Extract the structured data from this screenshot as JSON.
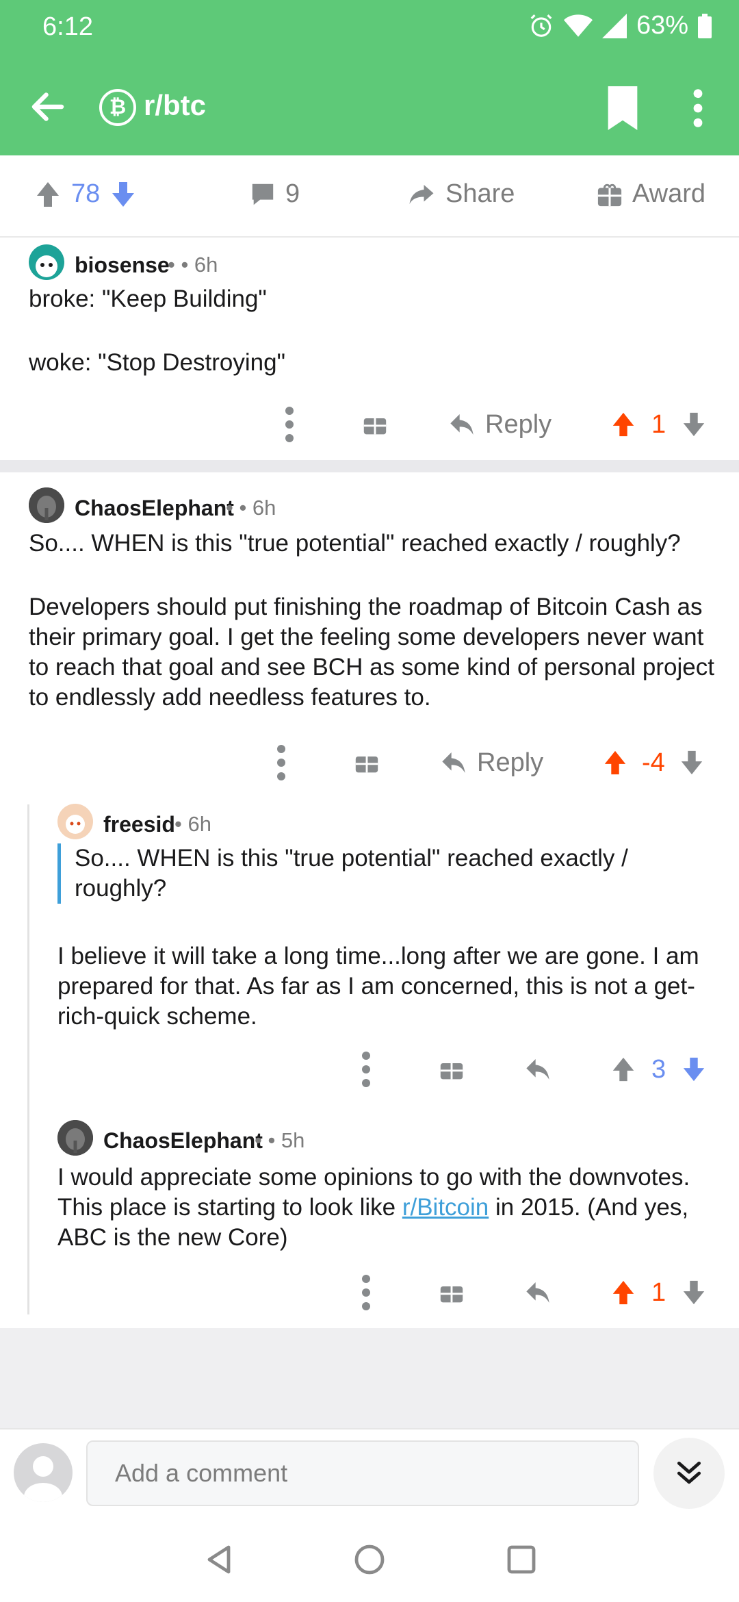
{
  "status": {
    "time": "6:12",
    "battery": "63%"
  },
  "header": {
    "subreddit": "r/btc",
    "sub_icon_glyph": "₿"
  },
  "post_actions": {
    "upvotes": "78",
    "comments": "9",
    "share": "Share",
    "award": "Award"
  },
  "comments": [
    {
      "author": "biosense",
      "meta": "• • 6h",
      "body_lines": [
        "broke: \"Keep Building\"",
        "woke: \"Stop Destroying\""
      ],
      "reply": "Reply",
      "score": "1",
      "vote_state": "up"
    },
    {
      "author": "ChaosElephant",
      "meta": "• • 6h",
      "body_p1": "So.... WHEN is this \"true potential\" reached exactly / roughly?",
      "body_p2": "Developers should put finishing the roadmap of Bitcoin Cash as their primary goal. I get the feeling some developers never want to reach that goal and see BCH as some kind of personal project to endlessly add needless features to.",
      "reply": "Reply",
      "score": "-4",
      "vote_state": "up"
    },
    {
      "author": "freesid",
      "meta": "• 6h",
      "quote": "So.... WHEN is this \"true potential\" reached exactly / roughly?",
      "body": "I believe it will take a long time...long after we are gone. I am prepared for that. As far as I am concerned, this is not a get-rich-quick scheme.",
      "score": "3",
      "vote_state": "down"
    },
    {
      "author": "ChaosElephant",
      "meta": "• • 5h",
      "body_before": "I would appreciate some opinions to go with the downvotes. This place is starting to look like ",
      "link": "r/Bitcoin",
      "body_after": " in 2015. (And yes, ABC is the new Core)",
      "score": "1",
      "vote_state": "up"
    }
  ],
  "compose": {
    "placeholder": "Add a comment"
  },
  "colors": {
    "header": "#5ec978",
    "upvote": "#ff4500",
    "downvote": "#6a8ef0",
    "link": "#3e9fd9"
  }
}
